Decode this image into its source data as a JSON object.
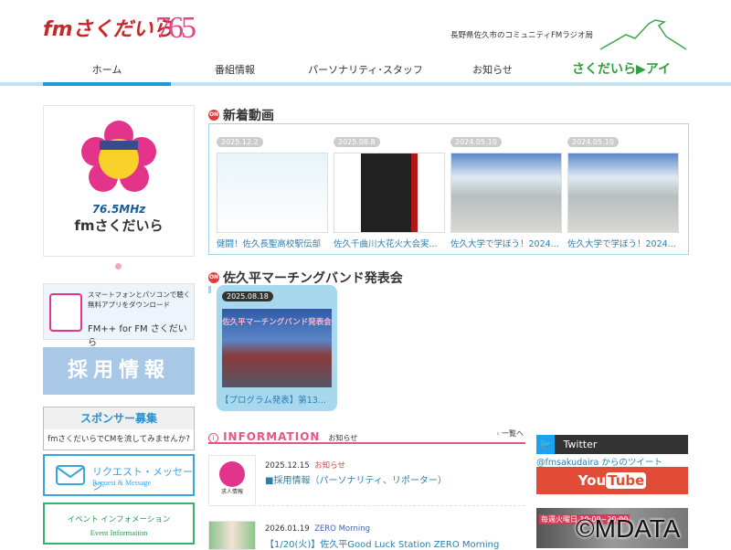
{
  "header": {
    "logo": "fmさくだいら",
    "logo_freq": "765",
    "tagline": "長野県佐久市のコミュニティFMラジオ局"
  },
  "nav": [
    {
      "label": "ホーム"
    },
    {
      "label": "番組情報"
    },
    {
      "label": "パーソナリティ･スタッフ"
    },
    {
      "label": "お知らせ"
    },
    {
      "label": "さくだいら▶アイ"
    }
  ],
  "sidebar": {
    "mascot_freq": "76.5MHz",
    "mascot_name": "fmさくだいら",
    "app": {
      "line1": "スマートフォンとパソコンで聴く",
      "line2": "無料アプリをダウンロード",
      "name": "FM++ for FM さくだいら"
    },
    "recruit": "採用情報",
    "sponsor": {
      "title": "スポンサー募集",
      "sub": "fmさくだいらでCMを流してみませんか?"
    },
    "request": {
      "title": "リクエスト・メッセージ",
      "sub": "Request & Message"
    },
    "event": {
      "title": "イベント インフォメーション",
      "sub": "Event Informaiton"
    }
  },
  "videos": {
    "title": "新着動画",
    "items": [
      {
        "date": "2025.12.2",
        "caption": "健闘！佐久長聖高校駅伝部"
      },
      {
        "date": "2025.08.8",
        "caption": "佐久千曲川大花火大会実..."
      },
      {
        "date": "2024.05.10",
        "caption": "佐久大学で学ぼう！2024..."
      },
      {
        "date": "2024.05.10",
        "caption": "佐久大学で学ぼう！2024..."
      }
    ]
  },
  "marching": {
    "title": "佐久平マーチングバンド発表会",
    "date": "2025.08.18",
    "thumb_text": "佐久平マーチングバンド発表会",
    "caption": "【プログラム発表】第13..."
  },
  "info": {
    "title": "INFORMATION",
    "sub": "お知らせ",
    "more": "一覧へ",
    "items": [
      {
        "date": "2025.12.15",
        "category": "お知らせ",
        "title": "■採用情報（パーソナリティ、リポーター）",
        "thumb": "求人情報"
      },
      {
        "date": "2026.01.19",
        "category": "ZERO Morning",
        "title": "【1/20(火)】佐久平Good Luck Station ZERO Morning"
      }
    ]
  },
  "right": {
    "twitter": "Twitter",
    "handle": "@fmsakudaira からのツイート",
    "youtube_you": "You",
    "youtube_tube": "Tube",
    "banner_text": "毎週火曜日 19:00~20:00"
  },
  "watermark": "©MDATA"
}
